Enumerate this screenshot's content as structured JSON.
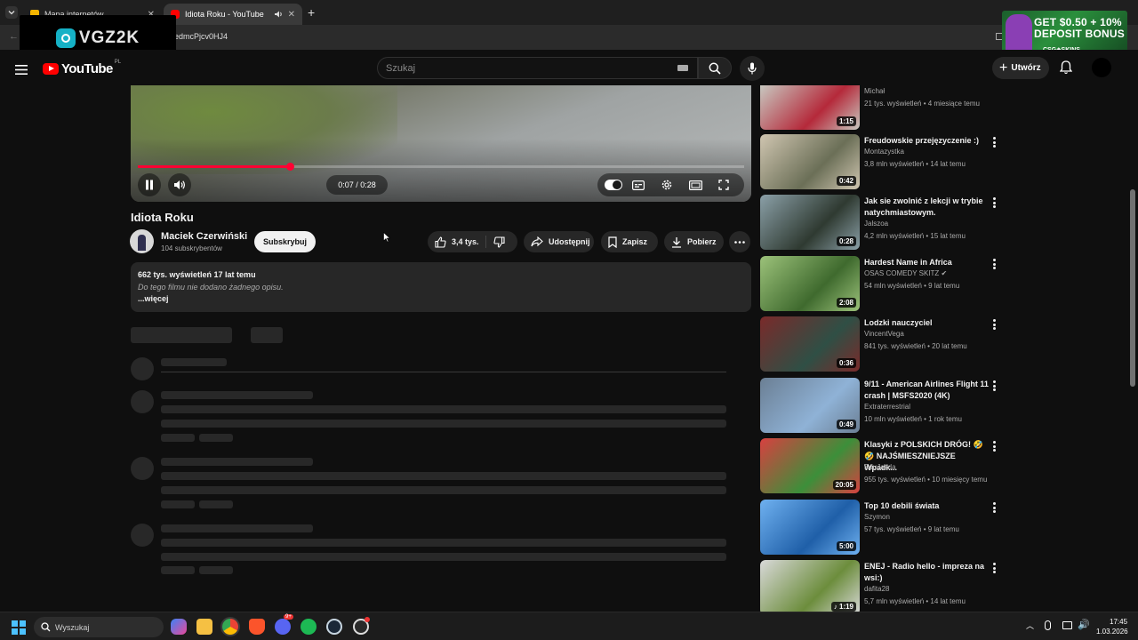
{
  "browser": {
    "tabs": [
      {
        "label": "Mapa internetów",
        "active": false
      },
      {
        "label": "Idiota Roku - YouTube",
        "active": true
      }
    ],
    "url_fragment": "edmcPjcv0HJ4"
  },
  "overlay": {
    "streamer_logo": "VGZ2K",
    "ad": {
      "line1": "GET $0.50 + 10%",
      "line2": "DEPOSIT BONUS",
      "brand": "CSG◈SKINS"
    }
  },
  "masthead": {
    "logo": "YouTube",
    "country": "PL",
    "search_placeholder": "Szukaj",
    "create_label": "Utwórz"
  },
  "player": {
    "current_time": "0:07",
    "duration": "0:28",
    "time_display": "0:07 / 0:28",
    "progress_fraction": 0.25,
    "autoplay_on": true,
    "accent": "#ff0033"
  },
  "video": {
    "title": "Idiota Roku",
    "channel": "Maciek Czerwiński",
    "subscribers": "104 subskrybentów",
    "subscribe_label": "Subskrybuj",
    "likes": "3,4 tys.",
    "share_label": "Udostępnij",
    "save_label": "Zapisz",
    "download_label": "Pobierz",
    "description": {
      "meta": "662 tys. wyświetleń  17 lat temu",
      "text": "Do tego filmu nie dodano żadnego opisu.",
      "more": "...więcej"
    }
  },
  "related": [
    {
      "title": "",
      "channel": "Michał",
      "meta": "21 tys. wyświetleń • 4 miesiące temu",
      "duration": "1:15",
      "thumb": "#b5293a",
      "thumb2": "#c8c8c0"
    },
    {
      "title": "Freudowskie przejęzyczenie :)",
      "channel": "Montazystka",
      "meta": "3,8 mln wyświetleń • 14 lat temu",
      "duration": "0:42",
      "thumb": "#6b6f57",
      "thumb2": "#d0c6b1"
    },
    {
      "title": "Jak sie zwolnić z lekcji w trybie natychmiastowym.",
      "channel": "Jalszoa",
      "meta": "4,2 mln wyświetleń • 15 lat temu",
      "duration": "0:28",
      "thumb": "#2f3a31",
      "thumb2": "#8ba0a8"
    },
    {
      "title": "Hardest Name in Africa",
      "channel": "OSAS COMEDY SKITZ ✔",
      "meta": "54 mln wyświetleń • 9 lat temu",
      "duration": "2:08",
      "thumb": "#3f6a2e",
      "thumb2": "#9cc27a"
    },
    {
      "title": "Lodzki nauczyciel",
      "channel": "VincentVega",
      "meta": "841 tys. wyświetleń • 20 lat temu",
      "duration": "0:36",
      "thumb": "#2f4f45",
      "thumb2": "#7a2a2a"
    },
    {
      "title": "9/11 - American Airlines Flight 11 crash | MSFS2020 (4K)",
      "channel": "Extraterrestrial",
      "meta": "10 mln wyświetleń • 1 rok temu",
      "duration": "0:49",
      "thumb": "#8fb2d6",
      "thumb2": "#6b7f94"
    },
    {
      "title": "Klasyki z POLSKICH DRÓG! 🤣 🤣 NAJŚMIESZNIEJSZE Wpadk...",
      "channel": "EduJazda",
      "meta": "955 tys. wyświetleń • 10 miesięcy temu",
      "duration": "20:05",
      "thumb": "#3c8f3a",
      "thumb2": "#d84040"
    },
    {
      "title": "Top 10 debili świata",
      "channel": "Szymon",
      "meta": "57 tys. wyświetleń • 9 lat temu",
      "duration": "5:00",
      "thumb": "#1f5fa8",
      "thumb2": "#6fb1f0"
    },
    {
      "title": "ENEJ - Radio hello - impreza na wsi:)",
      "channel": "dafita28",
      "meta": "5,7 mln wyświetleń • 14 lat temu",
      "duration": "♪ 1:19",
      "thumb": "#6c8d3c",
      "thumb2": "#d9d9d9"
    }
  ],
  "taskbar": {
    "search_placeholder": "Wyszukaj",
    "time": "17:45",
    "date": "1.03.2026",
    "discord_badge": "9+"
  }
}
